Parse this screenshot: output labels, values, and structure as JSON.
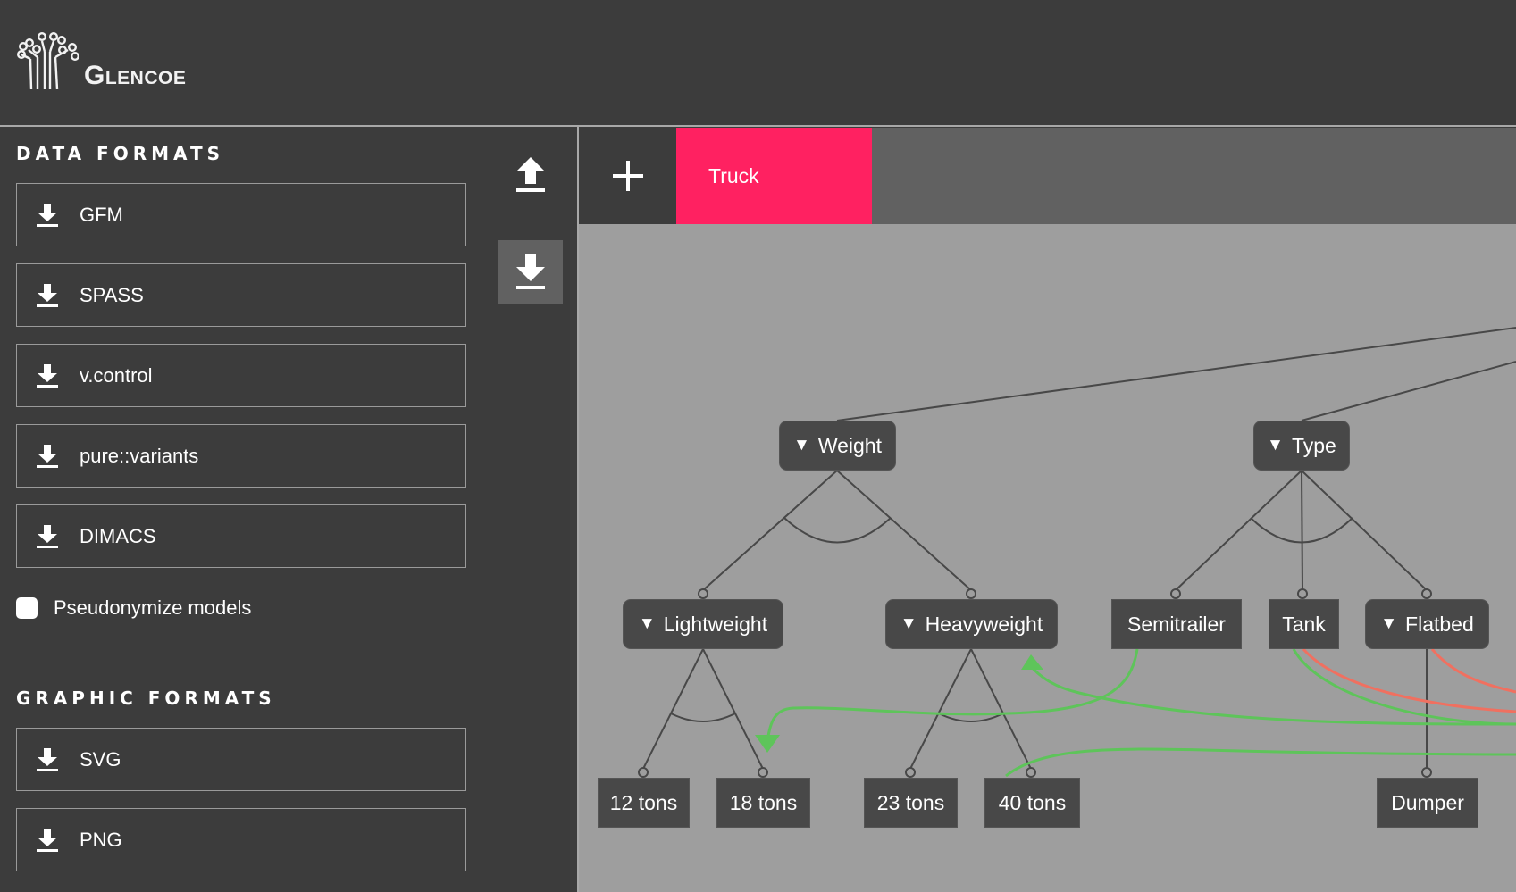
{
  "app": {
    "name": "Glencoe",
    "logo_icon": "tree-circuit-logo"
  },
  "sidebar": {
    "data_formats_title": "DATA FORMATS",
    "data_formats": [
      {
        "label": "GFM",
        "icon": "download-icon"
      },
      {
        "label": "SPASS",
        "icon": "download-icon"
      },
      {
        "label": "v.control",
        "icon": "download-icon"
      },
      {
        "label": "pure::variants",
        "icon": "download-icon"
      },
      {
        "label": "DIMACS",
        "icon": "download-icon"
      }
    ],
    "pseudonymize": {
      "label": "Pseudonymize models",
      "checked": false
    },
    "graphic_formats_title": "GRAPHIC FORMATS",
    "graphic_formats": [
      {
        "label": "SVG",
        "icon": "download-icon"
      },
      {
        "label": "PNG",
        "icon": "download-icon"
      }
    ],
    "actions": [
      {
        "name": "upload",
        "icon": "upload-icon",
        "active": false
      },
      {
        "name": "download",
        "icon": "download-icon",
        "active": true
      }
    ]
  },
  "tabs": {
    "add_icon": "plus-icon",
    "items": [
      {
        "label": "Truck",
        "active": true,
        "color": "#ff2161"
      }
    ]
  },
  "diagram": {
    "colors": {
      "canvas": "#9e9e9e",
      "node": "#484848",
      "edge": "#484848",
      "requires": "#5ec45a",
      "excludes": "#f07060"
    },
    "nodes": {
      "weight": {
        "label": "Weight",
        "collapsible": true,
        "collapse_glyph": "▼"
      },
      "type": {
        "label": "Type",
        "collapsible": true,
        "collapse_glyph": "▼"
      },
      "lightweight": {
        "label": "Lightweight",
        "collapsible": true,
        "collapse_glyph": "▼"
      },
      "heavyweight": {
        "label": "Heavyweight",
        "collapsible": true,
        "collapse_glyph": "▼"
      },
      "semitrailer": {
        "label": "Semitrailer",
        "collapsible": false
      },
      "tank": {
        "label": "Tank",
        "collapsible": false
      },
      "flatbed": {
        "label": "Flatbed",
        "collapsible": true,
        "collapse_glyph": "▼"
      },
      "t12": {
        "label": "12 tons",
        "collapsible": false
      },
      "t18": {
        "label": "18 tons",
        "collapsible": false
      },
      "t23": {
        "label": "23 tons",
        "collapsible": false
      },
      "t40": {
        "label": "40 tons",
        "collapsible": false
      },
      "dumper": {
        "label": "Dumper",
        "collapsible": false
      }
    },
    "groups": [
      {
        "parent": "Weight",
        "type": "alternative",
        "children": [
          "Lightweight",
          "Heavyweight"
        ]
      },
      {
        "parent": "Type",
        "type": "alternative",
        "children": [
          "Semitrailer",
          "Tank",
          "Flatbed"
        ]
      },
      {
        "parent": "Lightweight",
        "type": "alternative",
        "children": [
          "12 tons",
          "18 tons"
        ]
      },
      {
        "parent": "Heavyweight",
        "type": "alternative",
        "children": [
          "23 tons",
          "40 tons"
        ]
      },
      {
        "parent": "Flatbed",
        "type": "optional",
        "children": [
          "Dumper"
        ]
      }
    ],
    "constraints": [
      {
        "from": "Semitrailer",
        "to": "18 tons",
        "kind": "requires"
      },
      {
        "from": "Tank",
        "to": "Heavyweight",
        "kind": "requires"
      },
      {
        "from": "40 tons",
        "to": "(offscreen)",
        "kind": "requires"
      },
      {
        "from": "Tank",
        "to": "(offscreen)",
        "kind": "excludes"
      },
      {
        "from": "Flatbed",
        "to": "(offscreen)",
        "kind": "excludes"
      }
    ]
  }
}
